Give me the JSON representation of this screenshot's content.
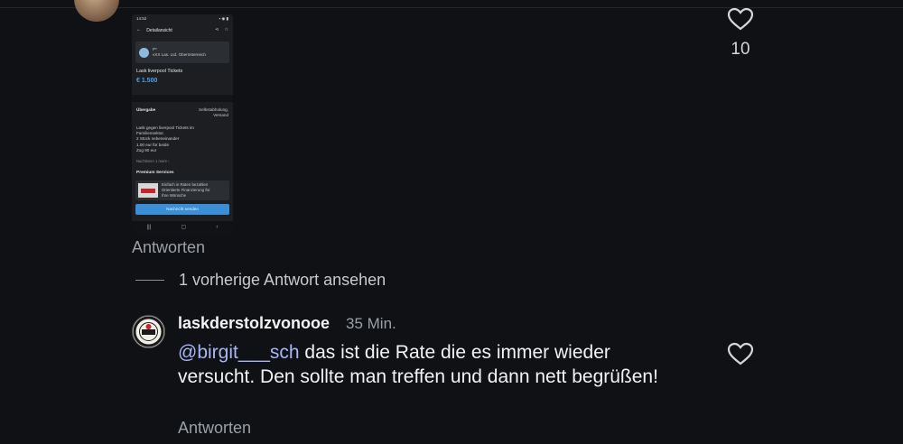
{
  "top_comment": {
    "like_count": "10",
    "reply_label": "Antworten",
    "screenshot": {
      "nav_title": "Detailansicht",
      "seller_line1": "P*",
      "seller_line2": "vXX Las. Ltd. Oberösterreich",
      "listing_title": "Lask liverpool Tickets",
      "price": "€ 1.500",
      "handover_label": "Übergabe",
      "handover_value": "Selbstabholung, Versand",
      "description": "Lask gegen liverpool Tickets im\nFamiliensektor.\n2 Stück nebeneinander\n1.00 eur für beide\nZug 90 eur",
      "more_label": "Nachlesen 1 more ›",
      "premium_label": "Premium Services",
      "promo_text": "Einfach in Raten bezahlen\nOrientierte Finanzierung für\nIhre Wünsche",
      "cta_label": "Nachricht senden",
      "sysnav": [
        "|||",
        "▢",
        "‹"
      ]
    }
  },
  "view_previous": "1 vorherige Antwort ansehen",
  "reply": {
    "username": "laskderstolzvonooe",
    "time": "35 Min.",
    "mention": "@birgit___sch",
    "text": " das ist die Rate die es immer wieder versucht. Den sollte man treffen und dann nett begrüßen!",
    "reply_label": "Antworten"
  },
  "colors": {
    "background": "#0f1115",
    "mention": "#a7b6f5",
    "muted": "#9aa0a6"
  },
  "icons": [
    "heart-icon",
    "back-arrow-icon",
    "share-icon",
    "star-icon"
  ]
}
